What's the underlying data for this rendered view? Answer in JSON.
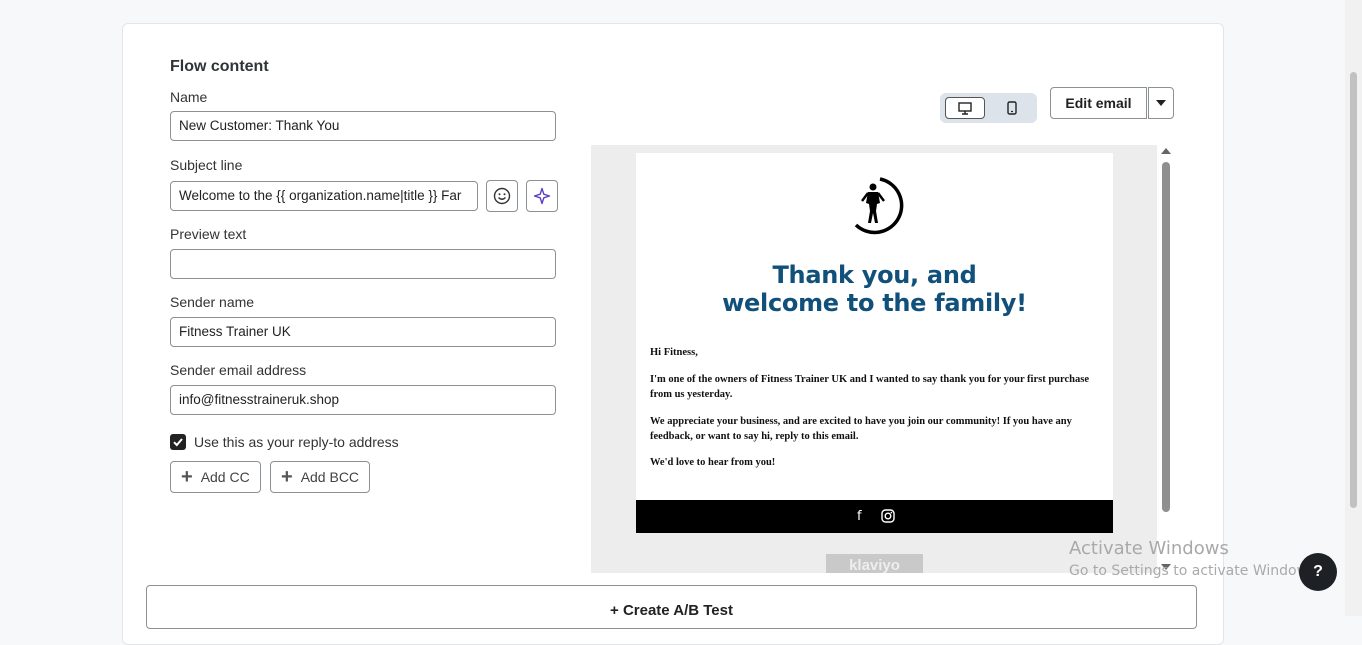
{
  "section_title": "Flow content",
  "form": {
    "name_label": "Name",
    "name_value": "New Customer: Thank You",
    "subject_label": "Subject line",
    "subject_value": "Welcome to the {{ organization.name|title }} Far",
    "preview_label": "Preview text",
    "preview_value": "",
    "sender_name_label": "Sender name",
    "sender_name_value": "Fitness Trainer UK",
    "sender_email_label": "Sender email address",
    "sender_email_value": "info@fitnesstraineruk.shop",
    "reply_to_label": "Use this as your reply-to address",
    "reply_to_checked": true,
    "add_cc_label": "Add CC",
    "add_bcc_label": "Add BCC",
    "icons": [
      "emoji-icon",
      "ai-sparkle-icon",
      "plus-icon",
      "checkmark-icon"
    ]
  },
  "toolbar": {
    "view_modes": [
      "desktop",
      "mobile"
    ],
    "active_view": "desktop",
    "edit_label": "Edit email"
  },
  "email_preview": {
    "headline_line1": "Thank you, and",
    "headline_line2": "welcome to the family!",
    "greeting": "Hi Fitness,",
    "paragraph1": "I'm one of the owners of Fitness Trainer UK and I wanted to say thank you for your first purchase from us yesterday.",
    "paragraph2": "We appreciate your business, and are excited to have you join our community! If you have any feedback, or want to say hi, reply to this email.",
    "closing": "We'd love to hear from you!",
    "social_icons": [
      "facebook-icon",
      "instagram-icon"
    ],
    "facebook_glyph": "f",
    "badge_text": "klaviyo",
    "headline_color": "#10507a"
  },
  "ab_test_label": "+ Create A/B Test",
  "watermark": {
    "line1": "Activate Windows",
    "line2": "Go to Settings to activate Windows."
  },
  "help_label": "?"
}
